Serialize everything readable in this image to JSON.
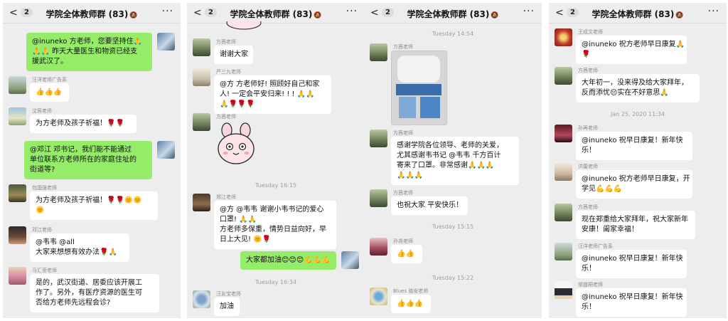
{
  "chat_title": "学院全体教师群 (83)",
  "mute_icon": "bell-off-icon",
  "back_glyph": "<",
  "unread_count": "2",
  "more_glyph": "···",
  "panels": [
    {
      "messages": [
        {
          "lines": [
            "@inuneko 方老师，您要坚持住🙏",
            "🙏🙏 昨天大量医生和物资已经支",
            "援武汉了。"
          ]
        },
        {
          "name": "汪洋老师广告系",
          "lines": [
            "👍👍👍"
          ]
        },
        {
          "name": "沈蓉老师",
          "lines": [
            "为方老师及孩子祈福！🌹🌹"
          ]
        },
        {
          "lines": [
            "@邓江 邓书记，我们能不能通过",
            "单位联系方老师所在的家庭住址的",
            "街道等?"
          ]
        },
        {
          "name": "包国强老师",
          "lines": [
            "为方老师及孩子祈福！🌹🌹🌞🌞",
            "🌞"
          ]
        },
        {
          "name": "邓江老师",
          "lines": [
            "@韦韦 @all",
            "大家来想想有效办法🌹🙏"
          ]
        },
        {
          "name": "马汇莹老师",
          "lines": [
            "是的，武汉街道、居委应该开展工",
            "作了。另外，有医疗资源的医生可",
            "否给方老师先远程会诊?"
          ]
        }
      ]
    },
    {
      "messages": [
        {
          "name": "方茜老师",
          "lines": [
            "谢谢大家"
          ]
        },
        {
          "name": "严三九老师",
          "lines": [
            "@方 方老师好! 照顾好自己和家",
            "人! 一定会平安归来! ! ! 🙏🙏",
            "🙏🌹🌹🌹"
          ]
        },
        {
          "name": "方茜老师",
          "sticker": "bunny-sticker"
        },
        {
          "time": "Tuesday 16:15"
        },
        {
          "name": "郑江老师",
          "lines": [
            "@方 @韦韦 谢谢小韦书记的爱心",
            "口罩! 🙏🙏",
            "方老师多保重，情势日益向好，早",
            "日上大见! 🌞🌹"
          ]
        },
        {
          "lines": [
            "大家都加油😊😊😊💪💪💪"
          ]
        },
        {
          "time": "Tuesday 16:34"
        },
        {
          "name": "汪友宝老师",
          "lines": [
            "加油"
          ]
        }
      ]
    },
    {
      "messages": [
        {
          "time": "Tuesday 14:54"
        },
        {
          "name": "方茜老师",
          "photo": "mask-package-photo"
        },
        {
          "name": "方茜老师",
          "lines": [
            "感谢学院各位领导、老师的关爱，",
            "尤其感谢韦书记 @韦韦 千方百计",
            "寄来了口罩。非常感谢🙏🙏🙏",
            "🙏🙏🙏"
          ]
        },
        {
          "name": "方茜老师",
          "lines": [
            "也祝大家 平安快乐！"
          ]
        },
        {
          "time": "Tuesday 15:15"
        },
        {
          "name": "孙尧老师",
          "lines": [
            "👍👍"
          ]
        },
        {
          "time": "Tuesday 15:22"
        },
        {
          "name": "Blues 骆安老师",
          "lines": [
            "👍👍👍"
          ]
        }
      ]
    },
    {
      "messages": [
        {
          "name": "王成文老师",
          "lines": [
            "@inuneko 祝方老师早日康复🙏",
            "🌹"
          ]
        },
        {
          "name": "方茜老师",
          "lines": [
            "大年初一，没来得及给大家拜年，",
            "反而添忧😔实在不好意思🙏"
          ]
        },
        {
          "time": "Jan 25, 2020 11:34"
        },
        {
          "name": "孙再老师",
          "lines": [
            "@inuneko 祝早日康复！新年快",
            "乐！"
          ]
        },
        {
          "name": "洪蕾老师",
          "lines": [
            "@inuneko 祝方老师早日康复，开",
            "学见💪💪💪"
          ]
        },
        {
          "name": "方茜老师",
          "lines": [
            "现在郑重给大家拜年，祝大家新年",
            "安康！阖家幸福！"
          ]
        },
        {
          "name": "汪洋老师广告系",
          "lines": [
            "@inuneko 祝早日康复！新年快",
            "乐！"
          ]
        },
        {
          "name": "邬盛桐老师",
          "lines": [
            "@inuneko 祝早日康复！新年快",
            "乐！"
          ]
        }
      ]
    }
  ]
}
